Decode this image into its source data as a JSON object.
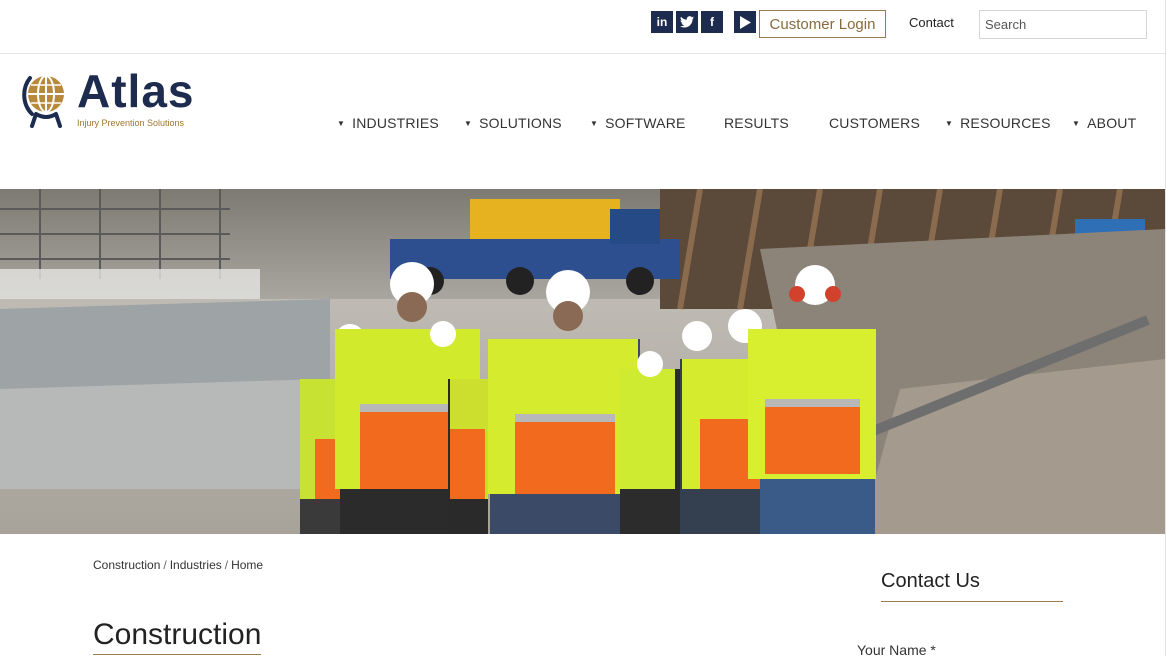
{
  "social": [
    {
      "name": "linkedin",
      "glyph": "in"
    },
    {
      "name": "twitter",
      "glyph": ""
    },
    {
      "name": "facebook",
      "glyph": "f"
    },
    {
      "name": "youtube",
      "glyph": ""
    }
  ],
  "header": {
    "login_label": "Customer Login",
    "contact_label": "Contact",
    "search_placeholder": "Search"
  },
  "brand": {
    "name": "Atlas",
    "tagline": "Injury Prevention Solutions",
    "primary_color": "#1d2b4f",
    "accent_color": "#a0762f"
  },
  "nav": {
    "items": [
      {
        "label": "INDUSTRIES",
        "dropdown": true
      },
      {
        "label": "SOLUTIONS",
        "dropdown": true
      },
      {
        "label": "SOFTWARE",
        "dropdown": true
      },
      {
        "label": "RESULTS",
        "dropdown": false
      },
      {
        "label": "CUSTOMERS",
        "dropdown": false
      },
      {
        "label": "RESOURCES",
        "dropdown": true
      },
      {
        "label": "ABOUT",
        "dropdown": true
      }
    ]
  },
  "breadcrumb": [
    "Construction",
    "Industries",
    "Home"
  ],
  "page": {
    "title": "Construction"
  },
  "sidebar": {
    "title": "Contact Us",
    "name_label": "Your Name *"
  }
}
